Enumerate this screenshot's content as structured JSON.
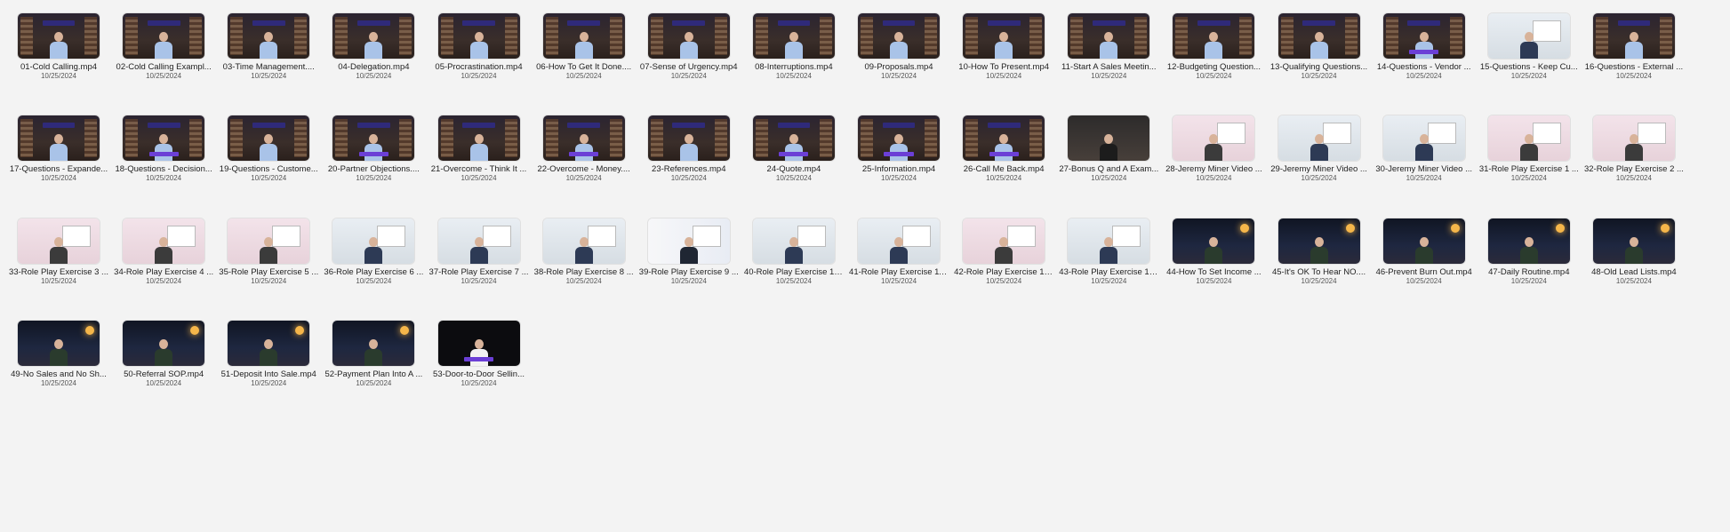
{
  "colors": {
    "background": "#f3f3f3",
    "filename_text": "#222222",
    "date_text": "#555555"
  },
  "files": [
    {
      "name": "01-Cold Calling.mp4",
      "date": "10/25/2024",
      "thumb": "studio"
    },
    {
      "name": "02-Cold Calling Exampl...",
      "date": "10/25/2024",
      "thumb": "studio"
    },
    {
      "name": "03-Time Management....",
      "date": "10/25/2024",
      "thumb": "studio"
    },
    {
      "name": "04-Delegation.mp4",
      "date": "10/25/2024",
      "thumb": "studio"
    },
    {
      "name": "05-Procrastination.mp4",
      "date": "10/25/2024",
      "thumb": "studio"
    },
    {
      "name": "06-How To Get It Done....",
      "date": "10/25/2024",
      "thumb": "studio"
    },
    {
      "name": "07-Sense of Urgency.mp4",
      "date": "10/25/2024",
      "thumb": "studio"
    },
    {
      "name": "08-Interruptions.mp4",
      "date": "10/25/2024",
      "thumb": "studio"
    },
    {
      "name": "09-Proposals.mp4",
      "date": "10/25/2024",
      "thumb": "studio"
    },
    {
      "name": "10-How To Present.mp4",
      "date": "10/25/2024",
      "thumb": "studio"
    },
    {
      "name": "11-Start A Sales Meetin...",
      "date": "10/25/2024",
      "thumb": "studio"
    },
    {
      "name": "12-Budgeting Question...",
      "date": "10/25/2024",
      "thumb": "studio"
    },
    {
      "name": "13-Qualifying Questions...",
      "date": "10/25/2024",
      "thumb": "studio"
    },
    {
      "name": "14-Questions - Vendor ...",
      "date": "10/25/2024",
      "thumb": "studio-caption"
    },
    {
      "name": "15-Questions - Keep Cu...",
      "date": "10/25/2024",
      "thumb": "office"
    },
    {
      "name": "16-Questions - External ...",
      "date": "10/25/2024",
      "thumb": "studio"
    },
    {
      "name": "17-Questions - Expande...",
      "date": "10/25/2024",
      "thumb": "studio"
    },
    {
      "name": "18-Questions - Decision...",
      "date": "10/25/2024",
      "thumb": "studio-caption"
    },
    {
      "name": "19-Questions - Custome...",
      "date": "10/25/2024",
      "thumb": "studio"
    },
    {
      "name": "20-Partner Objections....",
      "date": "10/25/2024",
      "thumb": "studio-caption"
    },
    {
      "name": "21-Overcome - Think It ...",
      "date": "10/25/2024",
      "thumb": "studio"
    },
    {
      "name": "22-Overcome - Money....",
      "date": "10/25/2024",
      "thumb": "studio-caption"
    },
    {
      "name": "23-References.mp4",
      "date": "10/25/2024",
      "thumb": "studio"
    },
    {
      "name": "24-Quote.mp4",
      "date": "10/25/2024",
      "thumb": "studio-caption"
    },
    {
      "name": "25-Information.mp4",
      "date": "10/25/2024",
      "thumb": "studio-caption"
    },
    {
      "name": "26-Call Me Back.mp4",
      "date": "10/25/2024",
      "thumb": "studio-caption"
    },
    {
      "name": "27-Bonus Q and A Exam...",
      "date": "10/25/2024",
      "thumb": "dark-room"
    },
    {
      "name": "28-Jeremy Miner Video ...",
      "date": "10/25/2024",
      "thumb": "pink-room"
    },
    {
      "name": "29-Jeremy Miner Video ...",
      "date": "10/25/2024",
      "thumb": "office"
    },
    {
      "name": "30-Jeremy Miner Video ...",
      "date": "10/25/2024",
      "thumb": "office"
    },
    {
      "name": "31-Role Play Exercise 1 ...",
      "date": "10/25/2024",
      "thumb": "pink-room"
    },
    {
      "name": "32-Role Play Exercise 2 ...",
      "date": "10/25/2024",
      "thumb": "pink-room"
    },
    {
      "name": "33-Role Play Exercise 3 ...",
      "date": "10/25/2024",
      "thumb": "pink-room"
    },
    {
      "name": "34-Role Play Exercise 4 ...",
      "date": "10/25/2024",
      "thumb": "pink-room"
    },
    {
      "name": "35-Role Play Exercise 5 ...",
      "date": "10/25/2024",
      "thumb": "pink-room"
    },
    {
      "name": "36-Role Play Exercise 6 ...",
      "date": "10/25/2024",
      "thumb": "office"
    },
    {
      "name": "37-Role Play Exercise 7 ...",
      "date": "10/25/2024",
      "thumb": "office"
    },
    {
      "name": "38-Role Play Exercise 8 ...",
      "date": "10/25/2024",
      "thumb": "office"
    },
    {
      "name": "39-Role Play Exercise 9 ...",
      "date": "10/25/2024",
      "thumb": "blue-board"
    },
    {
      "name": "40-Role Play Exercise 10...",
      "date": "10/25/2024",
      "thumb": "office"
    },
    {
      "name": "41-Role Play Exercise 11...",
      "date": "10/25/2024",
      "thumb": "office"
    },
    {
      "name": "42-Role Play Exercise 12...",
      "date": "10/25/2024",
      "thumb": "pink-room"
    },
    {
      "name": "43-Role Play Exercise 13...",
      "date": "10/25/2024",
      "thumb": "office"
    },
    {
      "name": "44-How To Set Income ...",
      "date": "10/25/2024",
      "thumb": "night-studio"
    },
    {
      "name": "45-It's OK To Hear NO....",
      "date": "10/25/2024",
      "thumb": "night-studio"
    },
    {
      "name": "46-Prevent Burn Out.mp4",
      "date": "10/25/2024",
      "thumb": "night-studio"
    },
    {
      "name": "47-Daily Routine.mp4",
      "date": "10/25/2024",
      "thumb": "night-studio"
    },
    {
      "name": "48-Old Lead Lists.mp4",
      "date": "10/25/2024",
      "thumb": "night-studio"
    },
    {
      "name": "49-No Sales and No Sh...",
      "date": "10/25/2024",
      "thumb": "night-studio"
    },
    {
      "name": "50-Referral SOP.mp4",
      "date": "10/25/2024",
      "thumb": "night-studio"
    },
    {
      "name": "51-Deposit Into Sale.mp4",
      "date": "10/25/2024",
      "thumb": "night-studio"
    },
    {
      "name": "52-Payment Plan Into A ...",
      "date": "10/25/2024",
      "thumb": "night-studio"
    },
    {
      "name": "53-Door-to-Door Sellin...",
      "date": "10/25/2024",
      "thumb": "black-caption"
    }
  ]
}
